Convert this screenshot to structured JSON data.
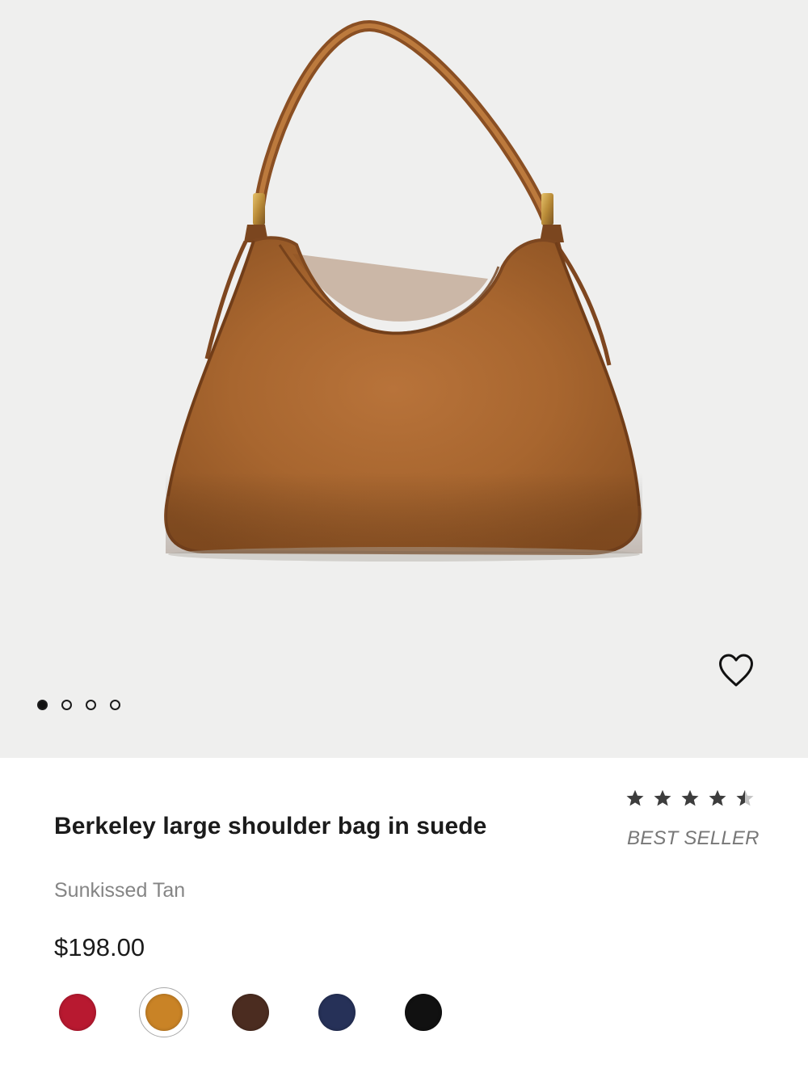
{
  "product": {
    "title": "Berkeley large shoulder bag in suede",
    "color_name": "Sunkissed Tan",
    "price": "$198.00",
    "badge": "BEST SELLER",
    "rating": {
      "value": 4.5,
      "max": 5,
      "filled_color": "#3d3d3d",
      "empty_color": "#c4c4c4"
    }
  },
  "gallery": {
    "background_color": "#efefee",
    "current_index": 0,
    "dots": [
      {
        "label": "Image 1",
        "active": true
      },
      {
        "label": "Image 2",
        "active": false
      },
      {
        "label": "Image 3",
        "active": false
      },
      {
        "label": "Image 4",
        "active": false
      }
    ],
    "wishlist_icon": "heart-outline-icon"
  },
  "swatches": [
    {
      "name": "Red",
      "color": "#b81930",
      "selected": false
    },
    {
      "name": "Sunkissed Tan",
      "color": "#c98326",
      "selected": true
    },
    {
      "name": "Brown",
      "color": "#4b2c20",
      "selected": false
    },
    {
      "name": "Navy",
      "color": "#263158",
      "selected": false
    },
    {
      "name": "Black",
      "color": "#111111",
      "selected": false
    }
  ],
  "colors": {
    "text_primary": "#1b1b1b",
    "text_secondary": "#858585",
    "accent_bag": "#a8672d"
  }
}
